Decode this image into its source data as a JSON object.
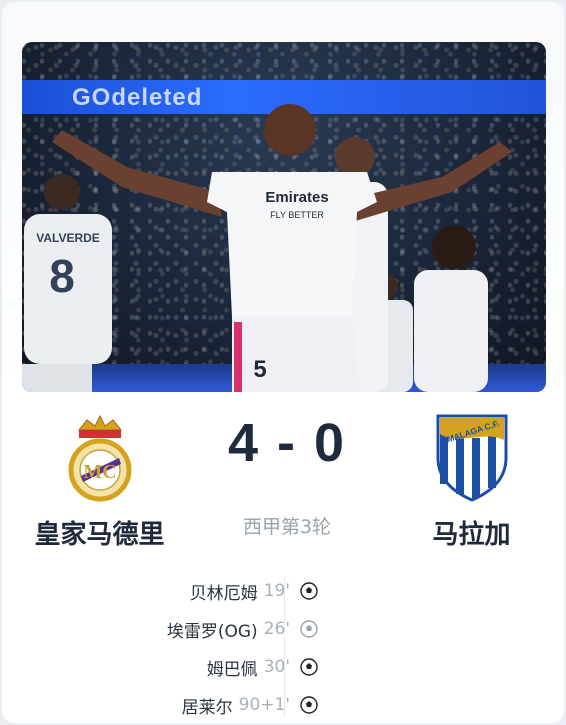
{
  "hero": {
    "ad_text": "GOdeleted",
    "jersey_sponsor": "Emirates",
    "jersey_tagline": "FLY BETTER",
    "main_player_number": "5",
    "left_player_name": "VALVERDE",
    "left_player_number": "8"
  },
  "match": {
    "home_team": "皇家马德里",
    "away_team": "马拉加",
    "score": "4 - 0",
    "round": "西甲第3轮",
    "away_crest_text": "MALAGA C.F."
  },
  "goals": [
    {
      "scorer": "贝林厄姆",
      "minute": "19'",
      "icon": "soccer-ball-icon"
    },
    {
      "scorer": "埃雷罗(OG)",
      "minute": "26'",
      "icon": "soccer-ball-own-goal-icon"
    },
    {
      "scorer": "姆巴佩",
      "minute": "30'",
      "icon": "soccer-ball-icon"
    },
    {
      "scorer": "居莱尔",
      "minute": "90+1'",
      "icon": "soccer-ball-icon"
    }
  ],
  "colors": {
    "accent_blue": "#2b6cff",
    "text_dark": "#1e2a3a",
    "text_muted": "#9aa3ad",
    "home_gold": "#d4a21f",
    "away_blue": "#1c4ea3"
  }
}
